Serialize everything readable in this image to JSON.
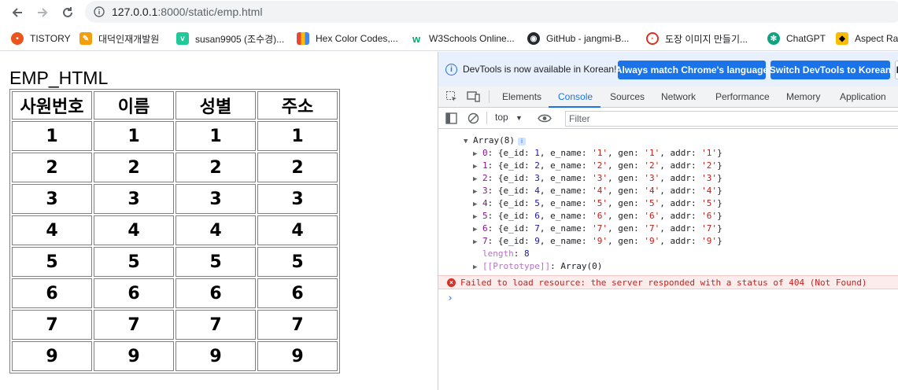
{
  "browser": {
    "url_host": "127.0.0.1",
    "url_path": ":8000/static/emp.html"
  },
  "bookmarks": [
    {
      "label": "TISTORY",
      "icon": "tistory-icon",
      "color": "#eb531f"
    },
    {
      "label": "대덕인재개발원",
      "icon": "ddit-icon",
      "color": "#f59e0b"
    },
    {
      "label": "susan9905 (조수경)...",
      "icon": "velog-icon",
      "color": "#20c997"
    },
    {
      "label": "Hex Color Codes,...",
      "icon": "book-icon",
      "color": "#e8453c"
    },
    {
      "label": "W3Schools Online...",
      "icon": "w3schools-icon",
      "color": "#04aa6d"
    },
    {
      "label": "GitHub - jangmi-B...",
      "icon": "github-icon",
      "color": "#24292f"
    },
    {
      "label": "도장 이미지 만들기...",
      "icon": "stamp-icon",
      "color": "#d93025"
    },
    {
      "label": "ChatGPT",
      "icon": "chatgpt-icon",
      "color": "#10a37f"
    },
    {
      "label": "Aspect Ra",
      "icon": "aspect-icon",
      "color": "#fbbc04"
    }
  ],
  "page": {
    "title": "EMP_HTML",
    "headers": [
      "사원번호",
      "이름",
      "성별",
      "주소"
    ],
    "rows": [
      [
        "1",
        "1",
        "1",
        "1"
      ],
      [
        "2",
        "2",
        "2",
        "2"
      ],
      [
        "3",
        "3",
        "3",
        "3"
      ],
      [
        "4",
        "4",
        "4",
        "4"
      ],
      [
        "5",
        "5",
        "5",
        "5"
      ],
      [
        "6",
        "6",
        "6",
        "6"
      ],
      [
        "7",
        "7",
        "7",
        "7"
      ],
      [
        "9",
        "9",
        "9",
        "9"
      ]
    ]
  },
  "devtools": {
    "info_text": "DevTools is now available in Korean!",
    "btn_match": "Always match Chrome's language",
    "btn_switch": "Switch DevTools to Korean",
    "btn_dont": "D",
    "tabs": [
      "Elements",
      "Console",
      "Sources",
      "Network",
      "Performance",
      "Memory",
      "Application"
    ],
    "active_tab": "Console",
    "context": "top",
    "filter_placeholder": "Filter",
    "console": {
      "array_header": "Array(8)",
      "items": [
        {
          "idx": "0",
          "e_id": "1",
          "val": "'1'"
        },
        {
          "idx": "1",
          "e_id": "2",
          "val": "'2'"
        },
        {
          "idx": "2",
          "e_id": "3",
          "val": "'3'"
        },
        {
          "idx": "3",
          "e_id": "4",
          "val": "'4'"
        },
        {
          "idx": "4",
          "e_id": "5",
          "val": "'5'"
        },
        {
          "idx": "5",
          "e_id": "6",
          "val": "'6'"
        },
        {
          "idx": "6",
          "e_id": "7",
          "val": "'7'"
        },
        {
          "idx": "7",
          "e_id": "9",
          "val": "'9'"
        }
      ],
      "length_label": "length",
      "length_value": "8",
      "prototype_label": "[[Prototype]]",
      "prototype_value": "Array(0)",
      "error": "Failed to load resource: the server responded with a status of 404 (Not Found)"
    }
  }
}
